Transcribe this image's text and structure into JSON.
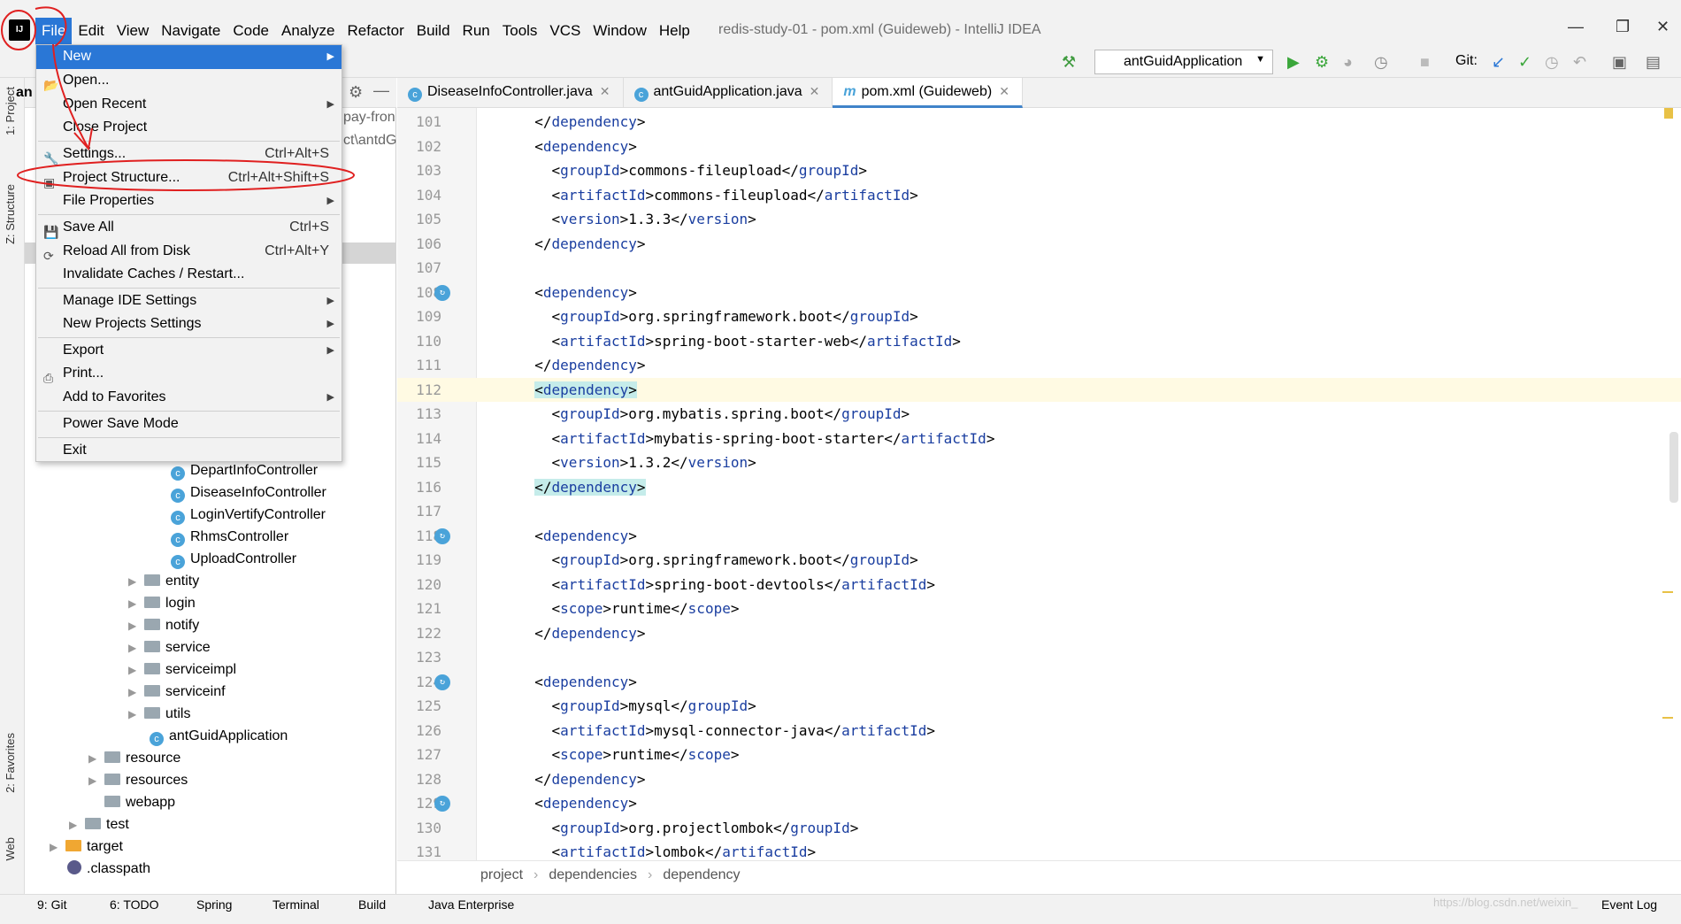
{
  "titlebar": {
    "app_icon_text": "IJ",
    "menus": [
      "File",
      "Edit",
      "View",
      "Navigate",
      "Code",
      "Analyze",
      "Refactor",
      "Build",
      "Run",
      "Tools",
      "VCS",
      "Window",
      "Help"
    ],
    "title": "redis-study-01 - pom.xml (Guideweb) - IntelliJ IDEA"
  },
  "toolbar": {
    "run_config": "antGuidApplication",
    "git_label": "Git:"
  },
  "project_panel": {
    "header_text": "an",
    "path_fragments": [
      "pay-fron",
      "ct\\antdG"
    ],
    "tree": [
      {
        "label": "DepartInfoController",
        "type": "class"
      },
      {
        "label": "DiseaseInfoController",
        "type": "class"
      },
      {
        "label": "LoginVertifyController",
        "type": "class"
      },
      {
        "label": "RhmsController",
        "type": "class"
      },
      {
        "label": "UploadController",
        "type": "class"
      },
      {
        "label": "entity",
        "type": "folder"
      },
      {
        "label": "login",
        "type": "folder"
      },
      {
        "label": "notify",
        "type": "folder"
      },
      {
        "label": "service",
        "type": "folder"
      },
      {
        "label": "serviceimpl",
        "type": "folder"
      },
      {
        "label": "serviceinf",
        "type": "folder"
      },
      {
        "label": "utils",
        "type": "folder"
      },
      {
        "label": "antGuidApplication",
        "type": "class"
      },
      {
        "label": "resource",
        "type": "folder"
      },
      {
        "label": "resources",
        "type": "folder"
      },
      {
        "label": "webapp",
        "type": "folder"
      },
      {
        "label": "test",
        "type": "folder"
      },
      {
        "label": "target",
        "type": "folder"
      },
      {
        "label": ".classpath",
        "type": "file"
      }
    ]
  },
  "side_tabs": {
    "project": "1: Project",
    "structure": "Z: Structure",
    "favorites": "2: Favorites",
    "web": "Web"
  },
  "editor": {
    "tabs": [
      {
        "label": "DiseaseInfoController.java",
        "active": false
      },
      {
        "label": "antGuidApplication.java",
        "active": false
      },
      {
        "label": "pom.xml (Guideweb)",
        "active": true
      }
    ],
    "lines": [
      {
        "n": "101",
        "code": "  </dependency>"
      },
      {
        "n": "102",
        "code": "  <dependency>"
      },
      {
        "n": "103",
        "code": "    <groupId>commons-fileupload</groupId>"
      },
      {
        "n": "104",
        "code": "    <artifactId>commons-fileupload</artifactId>"
      },
      {
        "n": "105",
        "code": "    <version>1.3.3</version>"
      },
      {
        "n": "106",
        "code": "  </dependency>"
      },
      {
        "n": "107",
        "code": ""
      },
      {
        "n": "108",
        "code": "  <dependency>"
      },
      {
        "n": "109",
        "code": "    <groupId>org.springframework.boot</groupId>"
      },
      {
        "n": "110",
        "code": "    <artifactId>spring-boot-starter-web</artifactId>"
      },
      {
        "n": "111",
        "code": "  </dependency>"
      },
      {
        "n": "112",
        "code": "  <dependency>"
      },
      {
        "n": "113",
        "code": "    <groupId>org.mybatis.spring.boot</groupId>"
      },
      {
        "n": "114",
        "code": "    <artifactId>mybatis-spring-boot-starter</artifactId>"
      },
      {
        "n": "115",
        "code": "    <version>1.3.2</version>"
      },
      {
        "n": "116",
        "code": "  </dependency>"
      },
      {
        "n": "117",
        "code": ""
      },
      {
        "n": "118",
        "code": "  <dependency>"
      },
      {
        "n": "119",
        "code": "    <groupId>org.springframework.boot</groupId>"
      },
      {
        "n": "120",
        "code": "    <artifactId>spring-boot-devtools</artifactId>"
      },
      {
        "n": "121",
        "code": "    <scope>runtime</scope>"
      },
      {
        "n": "122",
        "code": "  </dependency>"
      },
      {
        "n": "123",
        "code": ""
      },
      {
        "n": "124",
        "code": "  <dependency>"
      },
      {
        "n": "125",
        "code": "    <groupId>mysql</groupId>"
      },
      {
        "n": "126",
        "code": "    <artifactId>mysql-connector-java</artifactId>"
      },
      {
        "n": "127",
        "code": "    <scope>runtime</scope>"
      },
      {
        "n": "128",
        "code": "  </dependency>"
      },
      {
        "n": "129",
        "code": "  <dependency>"
      },
      {
        "n": "130",
        "code": "    <groupId>org.projectlombok</groupId>"
      },
      {
        "n": "131",
        "code": "    <artifactId>lombok</artifactId>"
      }
    ],
    "breadcrumb": [
      "project",
      "dependencies",
      "dependency"
    ]
  },
  "file_menu": {
    "items": [
      {
        "label": "New",
        "shortcut": "",
        "submenu": true
      },
      {
        "label": "Open...",
        "shortcut": "",
        "submenu": false
      },
      {
        "label": "Open Recent",
        "shortcut": "",
        "submenu": true
      },
      {
        "label": "Close Project",
        "shortcut": "",
        "submenu": false
      },
      {
        "label": "Settings...",
        "shortcut": "Ctrl+Alt+S",
        "submenu": false
      },
      {
        "label": "Project Structure...",
        "shortcut": "Ctrl+Alt+Shift+S",
        "submenu": false
      },
      {
        "label": "File Properties",
        "shortcut": "",
        "submenu": true
      },
      {
        "label": "Save All",
        "shortcut": "Ctrl+S",
        "submenu": false
      },
      {
        "label": "Reload All from Disk",
        "shortcut": "Ctrl+Alt+Y",
        "submenu": false
      },
      {
        "label": "Invalidate Caches / Restart...",
        "shortcut": "",
        "submenu": false
      },
      {
        "label": "Manage IDE Settings",
        "shortcut": "",
        "submenu": true
      },
      {
        "label": "New Projects Settings",
        "shortcut": "",
        "submenu": true
      },
      {
        "label": "Export",
        "shortcut": "",
        "submenu": true
      },
      {
        "label": "Print...",
        "shortcut": "",
        "submenu": false
      },
      {
        "label": "Add to Favorites",
        "shortcut": "",
        "submenu": true
      },
      {
        "label": "Power Save Mode",
        "shortcut": "",
        "submenu": false
      },
      {
        "label": "Exit",
        "shortcut": "",
        "submenu": false
      }
    ]
  },
  "bottom_tabs": [
    "9: Git",
    "6: TODO",
    "Spring",
    "Terminal",
    "Build",
    "Java Enterprise",
    "Event Log"
  ],
  "watermark": "https://blog.csdn.net/weixin_",
  "colors": {
    "accent": "#2a77d6",
    "annotation": "#e02020",
    "tag": "#1a3ea0"
  }
}
